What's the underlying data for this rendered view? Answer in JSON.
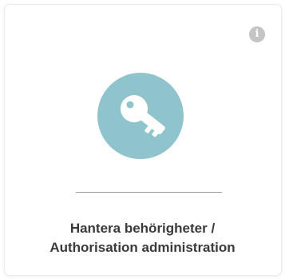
{
  "tile": {
    "title_line1": "Hantera behörigheter /",
    "title_line2": "Authorisation administration",
    "icon": "key-icon",
    "info_icon": "info-icon",
    "info_glyph": "i",
    "accent_color": "#8fc4cd"
  }
}
